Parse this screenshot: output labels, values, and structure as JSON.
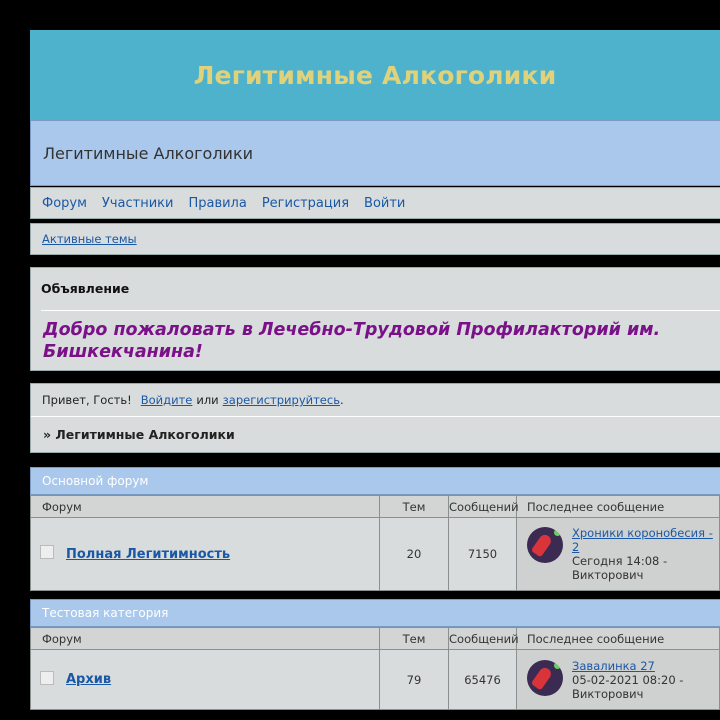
{
  "header": {
    "banner_title": "Легитимные Алкоголики",
    "subtitle": "Легитимные Алкоголики"
  },
  "nav": {
    "items": [
      "Форум",
      "Участники",
      "Правила",
      "Регистрация",
      "Войти"
    ],
    "active_topics": "Активные темы"
  },
  "announcement": {
    "heading": "Объявление",
    "text": "Добро пожаловать в Лечебно-Трудовой Профилакторий им. Бишкекчанина!"
  },
  "welcome": {
    "greeting": "Привет, Гость!",
    "login_link": "Войдите",
    "or": "или",
    "register_link": "зарегистрируйтесь",
    "period": ".",
    "breadcrumb": "» Легитимные Алкоголики"
  },
  "columns": {
    "forum": "Форум",
    "topics": "Тем",
    "posts": "Сообщений",
    "last_post": "Последнее сообщение"
  },
  "categories": [
    {
      "title": "Основной форум",
      "forums": [
        {
          "name": "Полная Легитимность",
          "topics": "20",
          "posts": "7150",
          "last_topic": "Хроники коронобесия - 2",
          "last_time": "Сегодня 14:08 -",
          "last_author": "Викторович"
        }
      ]
    },
    {
      "title": "Тестовая категория",
      "forums": [
        {
          "name": "Архив",
          "topics": "79",
          "posts": "65476",
          "last_topic": "Завалинка 27",
          "last_time": "05-02-2021 08:20 -",
          "last_author": "Викторович"
        }
      ]
    }
  ],
  "colors": {
    "banner": "#4fb2cc",
    "banner_text": "#e0d27a",
    "header_blue": "#a9c8ec",
    "link": "#1a58a6",
    "announcement_text": "#7a1188"
  }
}
